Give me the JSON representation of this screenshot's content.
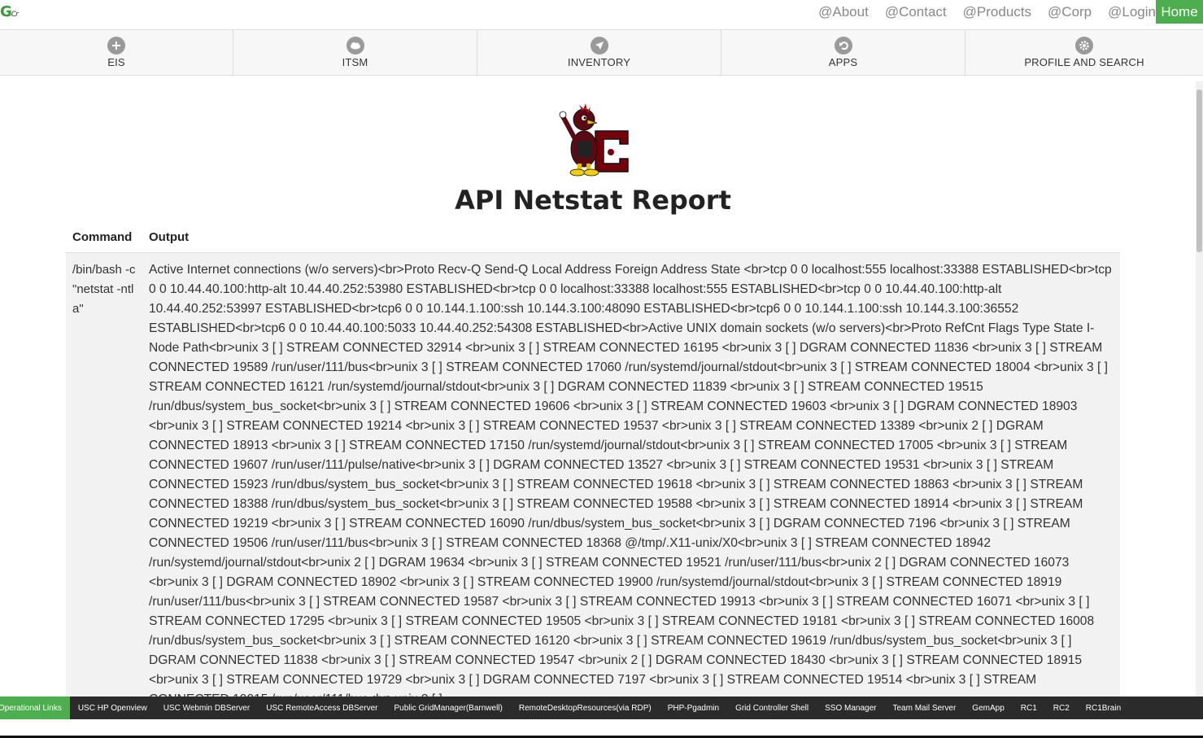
{
  "brand": {
    "logo_text": "G",
    "logo_sub": "Cr"
  },
  "top_links": [
    "@About",
    "@Contact",
    "@Products",
    "@Corp",
    "@Login"
  ],
  "home_label": "Home",
  "nav": [
    {
      "label": "EIS",
      "icon": "plus-circle-icon"
    },
    {
      "label": "ITSM",
      "icon": "cloud-icon"
    },
    {
      "label": "INVENTORY",
      "icon": "paper-plane-icon"
    },
    {
      "label": "APPS",
      "icon": "undo-icon"
    },
    {
      "label": "PROFILE AND SEARCH",
      "icon": "gear-icon"
    }
  ],
  "page": {
    "title": "API Netstat Report",
    "table": {
      "headers": {
        "command": "Command",
        "output": "Output"
      },
      "row": {
        "command": "/bin/bash -c \"netstat -ntla\"",
        "output": "Active Internet connections (w/o servers)<br>Proto Recv-Q Send-Q Local Address Foreign Address State <br>tcp 0 0 localhost:555 localhost:33388 ESTABLISHED<br>tcp 0 0 10.44.40.100:http-alt 10.44.40.252:53980 ESTABLISHED<br>tcp 0 0 localhost:33388 localhost:555 ESTABLISHED<br>tcp 0 0 10.44.40.100:http-alt 10.44.40.252:53997 ESTABLISHED<br>tcp6 0 0 10.144.1.100:ssh 10.144.3.100:48090 ESTABLISHED<br>tcp6 0 0 10.144.1.100:ssh 10.144.3.100:36552 ESTABLISHED<br>tcp6 0 0 10.44.40.100:5033 10.44.40.252:54308 ESTABLISHED<br>Active UNIX domain sockets (w/o servers)<br>Proto RefCnt Flags Type State I-Node Path<br>unix 3 [ ] STREAM CONNECTED 32914 <br>unix 3 [ ] STREAM CONNECTED 16195 <br>unix 3 [ ] DGRAM CONNECTED 11836 <br>unix 3 [ ] STREAM CONNECTED 19589 /run/user/111/bus<br>unix 3 [ ] STREAM CONNECTED 17060 /run/systemd/journal/stdout<br>unix 3 [ ] STREAM CONNECTED 18004 <br>unix 3 [ ] STREAM CONNECTED 16121 /run/systemd/journal/stdout<br>unix 3 [ ] DGRAM CONNECTED 11839 <br>unix 3 [ ] STREAM CONNECTED 19515 /run/dbus/system_bus_socket<br>unix 3 [ ] STREAM CONNECTED 19606 <br>unix 3 [ ] STREAM CONNECTED 19603 <br>unix 3 [ ] DGRAM CONNECTED 18903 <br>unix 3 [ ] STREAM CONNECTED 19214 <br>unix 3 [ ] STREAM CONNECTED 19537 <br>unix 3 [ ] STREAM CONNECTED 13389 <br>unix 2 [ ] DGRAM CONNECTED 18913 <br>unix 3 [ ] STREAM CONNECTED 17150 /run/systemd/journal/stdout<br>unix 3 [ ] STREAM CONNECTED 17005 <br>unix 3 [ ] STREAM CONNECTED 19607 /run/user/111/pulse/native<br>unix 3 [ ] DGRAM CONNECTED 13527 <br>unix 3 [ ] STREAM CONNECTED 19531 <br>unix 3 [ ] STREAM CONNECTED 15923 /run/dbus/system_bus_socket<br>unix 3 [ ] STREAM CONNECTED 19618 <br>unix 3 [ ] STREAM CONNECTED 18863 <br>unix 3 [ ] STREAM CONNECTED 18388 /run/dbus/system_bus_socket<br>unix 3 [ ] STREAM CONNECTED 19588 <br>unix 3 [ ] STREAM CONNECTED 18914 <br>unix 3 [ ] STREAM CONNECTED 19219 <br>unix 3 [ ] STREAM CONNECTED 16090 /run/dbus/system_bus_socket<br>unix 3 [ ] DGRAM CONNECTED 7196 <br>unix 3 [ ] STREAM CONNECTED 19506 /run/user/111/bus<br>unix 3 [ ] STREAM CONNECTED 18368 @/tmp/.X11-unix/X0<br>unix 3 [ ] STREAM CONNECTED 18942 /run/systemd/journal/stdout<br>unix 2 [ ] DGRAM 19634 <br>unix 3 [ ] STREAM CONNECTED 19521 /run/user/111/bus<br>unix 2 [ ] DGRAM CONNECTED 16073 <br>unix 3 [ ] DGRAM CONNECTED 18902 <br>unix 3 [ ] STREAM CONNECTED 19900 /run/systemd/journal/stdout<br>unix 3 [ ] STREAM CONNECTED 18919 /run/user/111/bus<br>unix 3 [ ] STREAM CONNECTED 19587 <br>unix 3 [ ] STREAM CONNECTED 19913 <br>unix 3 [ ] STREAM CONNECTED 16071 <br>unix 3 [ ] STREAM CONNECTED 17295 <br>unix 3 [ ] STREAM CONNECTED 19505 <br>unix 3 [ ] STREAM CONNECTED 19181 <br>unix 3 [ ] STREAM CONNECTED 16008 /run/dbus/system_bus_socket<br>unix 3 [ ] STREAM CONNECTED 16120 <br>unix 3 [ ] STREAM CONNECTED 19619 /run/dbus/system_bus_socket<br>unix 3 [ ] DGRAM CONNECTED 11838 <br>unix 3 [ ] STREAM CONNECTED 19547 <br>unix 2 [ ] DGRAM CONNECTED 18430 <br>unix 3 [ ] STREAM CONNECTED 18915 <br>unix 3 [ ] STREAM CONNECTED 19729 <br>unix 3 [ ] DGRAM CONNECTED 7197 <br>unix 3 [ ] STREAM CONNECTED 19514 <br>unix 3 [ ] STREAM CONNECTED 19015 /run/user/111/bus<br>unix 3 [ ]"
      }
    }
  },
  "footer": {
    "first": "Operational Links",
    "links": [
      "USC HP Openview",
      "USC Webmin DBServer",
      "USC RemoteAccess DBServer",
      "Public GridManager(Barnwell)",
      "RemoteDesktopResources(via RDP)",
      "PHP-Pgadmin",
      "Grid Controller Shell",
      "SSO Manager",
      "Team Mail Server",
      "GemApp",
      "RC1",
      "RC2",
      "RC1Brain"
    ]
  },
  "colors": {
    "accent": "#4cae4c",
    "footer_bg": "#2b2b2b",
    "nav_icon": "#9a9a9a"
  }
}
